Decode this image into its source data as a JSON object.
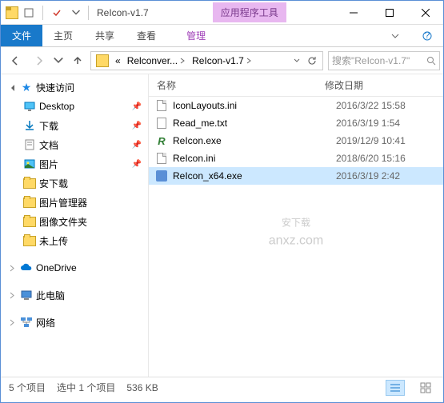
{
  "window": {
    "title": "ReIcon-v1.7",
    "context_tab": "应用程序工具"
  },
  "ribbon": {
    "file": "文件",
    "tabs": [
      "主页",
      "共享",
      "查看"
    ],
    "context": "管理"
  },
  "nav": {
    "breadcrumb": [
      "«",
      "Relconver...",
      "ReIcon-v1.7"
    ],
    "search_placeholder": "搜索\"ReIcon-v1.7\""
  },
  "sidebar": {
    "quick_access": "快速访问",
    "items": [
      {
        "label": "Desktop",
        "pinned": true,
        "icon": "desktop"
      },
      {
        "label": "下载",
        "pinned": true,
        "icon": "download"
      },
      {
        "label": "文档",
        "pinned": true,
        "icon": "document"
      },
      {
        "label": "图片",
        "pinned": true,
        "icon": "picture"
      },
      {
        "label": "安下载",
        "pinned": false,
        "icon": "folder"
      },
      {
        "label": "图片管理器",
        "pinned": false,
        "icon": "folder"
      },
      {
        "label": "图像文件夹",
        "pinned": false,
        "icon": "folder"
      },
      {
        "label": "未上传",
        "pinned": false,
        "icon": "folder"
      }
    ],
    "onedrive": "OneDrive",
    "this_pc": "此电脑",
    "network": "网络"
  },
  "columns": {
    "name": "名称",
    "date": "修改日期"
  },
  "files": [
    {
      "name": "IconLayouts.ini",
      "date": "2016/3/22 15:58",
      "type": "ini"
    },
    {
      "name": "Read_me.txt",
      "date": "2016/3/19 1:54",
      "type": "txt"
    },
    {
      "name": "ReIcon.exe",
      "date": "2019/12/9 10:41",
      "type": "reicon"
    },
    {
      "name": "ReIcon.ini",
      "date": "2018/6/20 15:16",
      "type": "ini"
    },
    {
      "name": "ReIcon_x64.exe",
      "date": "2016/3/19 2:42",
      "type": "exe",
      "selected": true
    }
  ],
  "status": {
    "count": "5 个项目",
    "selected": "选中 1 个项目",
    "size": "536 KB"
  },
  "watermark": {
    "main": "安下载",
    "sub": "anxz.com"
  }
}
